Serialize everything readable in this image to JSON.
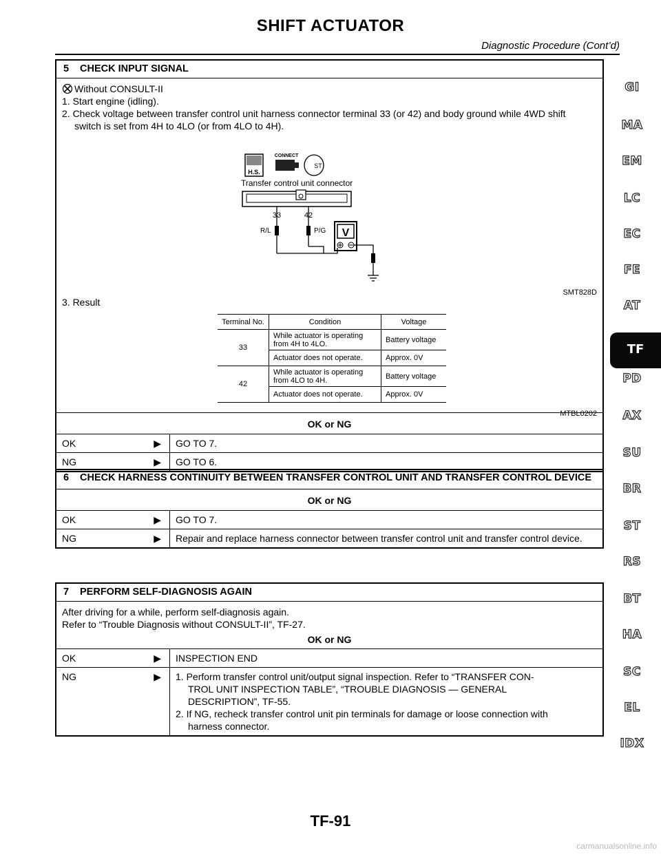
{
  "header": {
    "title": "SHIFT ACTUATOR",
    "subtitle": "Diagnostic Procedure (Cont’d)"
  },
  "step5": {
    "number": "5",
    "title": "CHECK INPUT SIGNAL",
    "mode": "Without CONSULT-II",
    "line1": "1. Start engine (idling).",
    "line2a": "2. Check voltage between transfer control unit harness connector terminal 33 (or 42) and body ground while 4WD shift",
    "line2b": "switch is set from 4H to 4LO (or from 4LO to 4H).",
    "figure1": {
      "connect_label": "CONNECT",
      "hs_label": "H.S.",
      "st_label": "ST",
      "connector_label": "Transfer control unit connector",
      "pin_a": "33",
      "pin_b": "42",
      "wire_a": "R/L",
      "wire_b": "P/G",
      "meter": "V",
      "code": "SMT828D"
    },
    "line3": "3. Result",
    "table": {
      "headers": [
        "Terminal No.",
        "Condition",
        "Voltage"
      ],
      "rows": [
        {
          "terminal": "33",
          "cond1": "While actuator is operating from 4H to 4LO.",
          "volt1": "Battery voltage",
          "cond2": "Actuator does not operate.",
          "volt2": "Approx. 0V"
        },
        {
          "terminal": "42",
          "cond1": "While actuator is operating from 4LO to 4H.",
          "volt1": "Battery voltage",
          "cond2": "Actuator does not operate.",
          "volt2": "Approx. 0V"
        }
      ],
      "code": "MTBL0202"
    },
    "okng": "OK or NG",
    "ok_label": "OK",
    "ok_action": "GO TO 7.",
    "ng_label": "NG",
    "ng_action": "GO TO 6."
  },
  "step6": {
    "number": "6",
    "title": "CHECK HARNESS CONTINUITY BETWEEN TRANSFER CONTROL UNIT AND TRANSFER CONTROL DEVICE",
    "okng": "OK or NG",
    "ok_label": "OK",
    "ok_action": "GO TO 7.",
    "ng_label": "NG",
    "ng_action": "Repair and replace harness connector between transfer control unit and transfer control device."
  },
  "step7": {
    "number": "7",
    "title": "PERFORM SELF-DIAGNOSIS AGAIN",
    "body1": "After driving for a while, perform self-diagnosis again.",
    "body2": "Refer to “Trouble Diagnosis without CONSULT-II”, TF-27.",
    "okng": "OK or NG",
    "ok_label": "OK",
    "ok_action": "INSPECTION END",
    "ng_label": "NG",
    "ng_action1a": "1. Perform transfer control unit/output signal inspection. Refer to “TRANSFER CON-",
    "ng_action1b": "TROL UNIT INSPECTION TABLE”, “TROUBLE DIAGNOSIS — GENERAL",
    "ng_action1c": "DESCRIPTION”, TF-55.",
    "ng_action2a": "2. If NG, recheck transfer control unit pin terminals for damage or loose connection with",
    "ng_action2b": "harness connector."
  },
  "arrow_glyph": "▶",
  "side_tabs": [
    "GI",
    "MA",
    "EM",
    "LC",
    "EC",
    "FE",
    "AT",
    "TF",
    "PD",
    "AX",
    "SU",
    "BR",
    "ST",
    "RS",
    "BT",
    "HA",
    "SC",
    "EL",
    "IDX"
  ],
  "footer": "TF-91",
  "watermark": "carmanualsonline.info"
}
